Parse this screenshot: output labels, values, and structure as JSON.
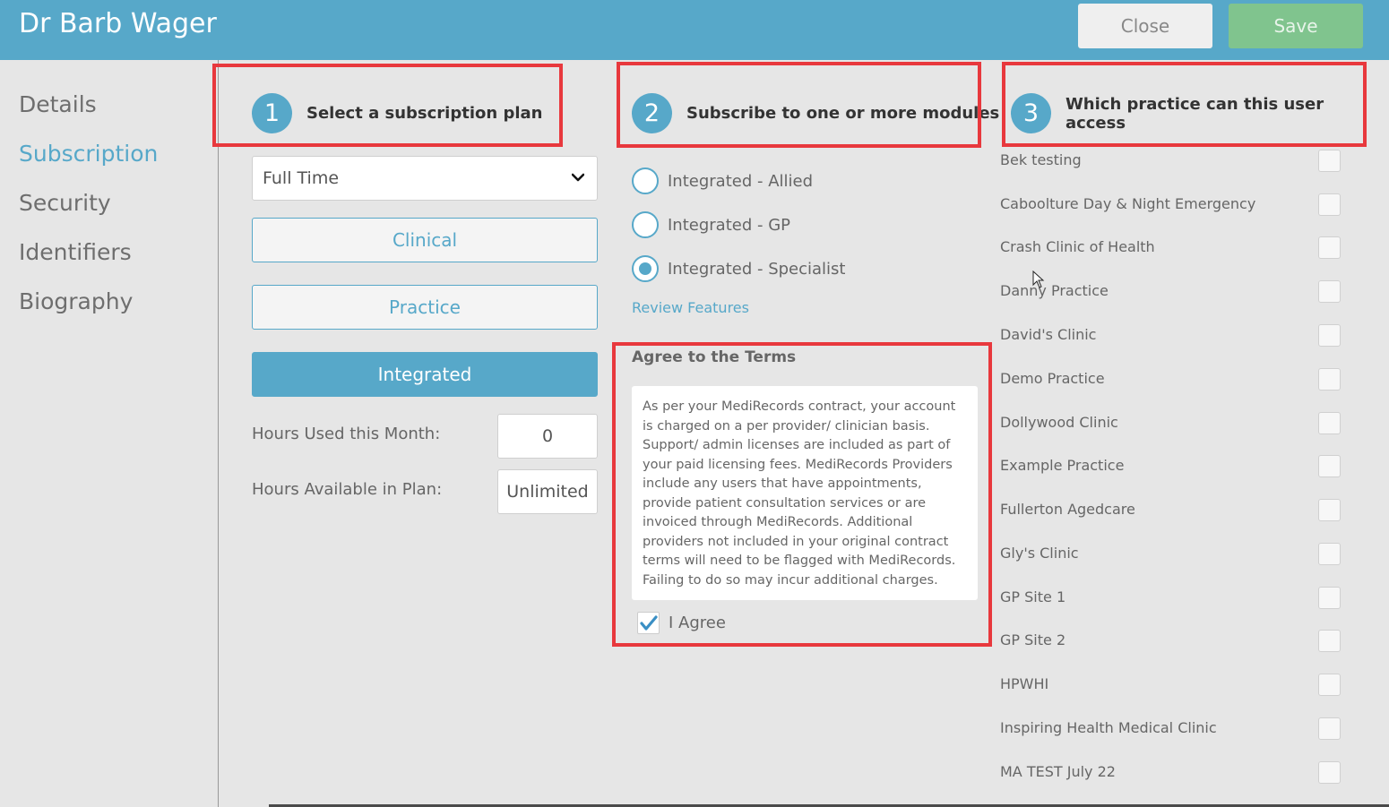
{
  "header": {
    "title": "Dr Barb Wager",
    "close_label": "Close",
    "save_label": "Save"
  },
  "sidebar": {
    "items": [
      {
        "label": "Details",
        "active": false
      },
      {
        "label": "Subscription",
        "active": true
      },
      {
        "label": "Security",
        "active": false
      },
      {
        "label": "Identifiers",
        "active": false
      },
      {
        "label": "Biography",
        "active": false
      }
    ]
  },
  "steps": [
    {
      "number": "1",
      "label": "Select a subscription plan"
    },
    {
      "number": "2",
      "label": "Subscribe to one or more modules"
    },
    {
      "number": "3",
      "label": "Which practice can this user access"
    }
  ],
  "plan": {
    "employment_type": "Full Time",
    "buttons": [
      {
        "label": "Clinical",
        "active": false
      },
      {
        "label": "Practice",
        "active": false
      },
      {
        "label": "Integrated",
        "active": true
      }
    ],
    "hours_used_label": "Hours Used this Month:",
    "hours_used_value": "0",
    "hours_available_label": "Hours Available in Plan:",
    "hours_available_value": "Unlimited"
  },
  "modules": {
    "options": [
      {
        "label": "Integrated - Allied",
        "checked": false
      },
      {
        "label": "Integrated - GP",
        "checked": false
      },
      {
        "label": "Integrated - Specialist",
        "checked": true
      }
    ],
    "review_link": "Review Features"
  },
  "terms": {
    "title": "Agree to the Terms",
    "text": "As per your MediRecords contract, your account is charged on a per provider/ clinician basis. Support/ admin licenses are included as part of your paid licensing fees. MediRecords Providers include any users that have appointments, provide patient consultation services or are invoiced through MediRecords. Additional providers not included in your original contract terms will need to be flagged with MediRecords. Failing to do so may incur additional charges.",
    "agree_label": "I Agree",
    "agreed": true
  },
  "practices": [
    {
      "name": "Bek testing",
      "checked": false
    },
    {
      "name": "Caboolture Day & Night Emergency",
      "checked": false
    },
    {
      "name": "Crash Clinic of Health",
      "checked": false
    },
    {
      "name": "Danny Practice",
      "checked": false
    },
    {
      "name": "David's Clinic",
      "checked": false
    },
    {
      "name": "Demo Practice",
      "checked": false
    },
    {
      "name": "Dollywood Clinic",
      "checked": false
    },
    {
      "name": "Example Practice",
      "checked": false
    },
    {
      "name": "Fullerton Agedcare",
      "checked": false
    },
    {
      "name": "Gly's Clinic",
      "checked": false
    },
    {
      "name": "GP Site 1",
      "checked": false
    },
    {
      "name": "GP Site 2",
      "checked": false
    },
    {
      "name": "HPWHI",
      "checked": false
    },
    {
      "name": "Inspiring Health Medical Clinic",
      "checked": false
    },
    {
      "name": "MA TEST July 22",
      "checked": false
    }
  ],
  "colors": {
    "accent": "#57a8c9",
    "save": "#80c48e",
    "highlight": "#e8383d"
  }
}
